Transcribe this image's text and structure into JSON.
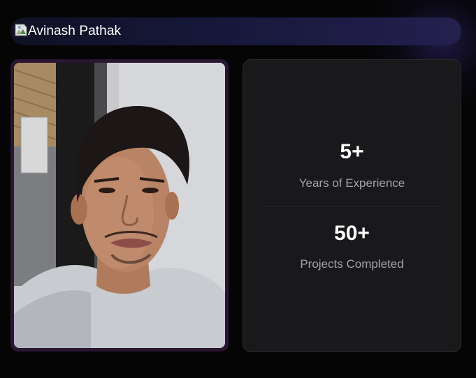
{
  "profile": {
    "name": "Avinash Pathak",
    "image_alt": "Avinash Pathak"
  },
  "stats": [
    {
      "value": "5+",
      "label": "Years of Experience"
    },
    {
      "value": "50+",
      "label": "Projects Completed"
    }
  ],
  "colors": {
    "background": "#050505",
    "name_bar_start": "#0f1124",
    "name_bar_end": "#24204f",
    "photo_frame": "#2a1630",
    "card_background": "#19191b",
    "stat_value": "#ffffff",
    "stat_label": "#a4a4a8"
  },
  "icons": {
    "profile_image": "broken-image-icon"
  }
}
